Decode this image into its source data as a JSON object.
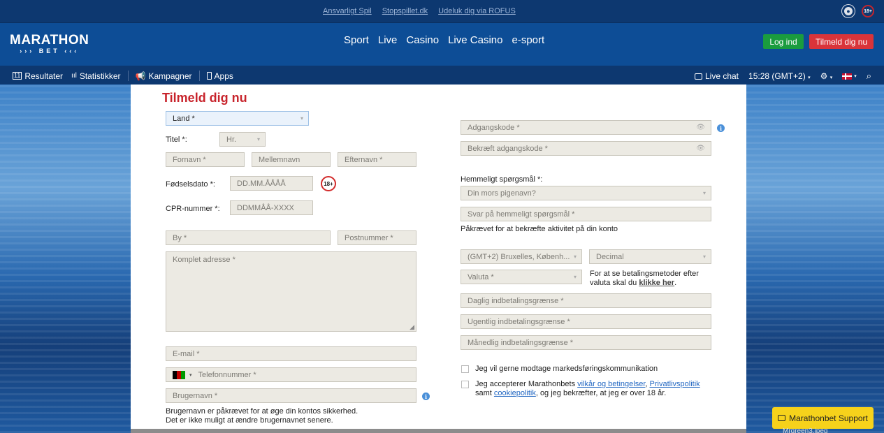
{
  "topbar": {
    "links": [
      "Ansvarligt Spil",
      "Stopspillet.dk",
      "Udeluk dig via ROFUS"
    ],
    "age_badge": "18+"
  },
  "header": {
    "logo_main": "MARATHON",
    "logo_sub": "BET",
    "nav": [
      "Sport",
      "Live",
      "Casino",
      "Live Casino",
      "e-sport"
    ],
    "login_label": "Log ind",
    "signup_label": "Tilmeld dig nu"
  },
  "subnav": {
    "results": "Resultater",
    "stats": "Statistikker",
    "promos": "Kampagner",
    "apps": "Apps",
    "live_chat": "Live chat",
    "time": "15:28 (GMT+2)"
  },
  "form": {
    "title": "Tilmeld dig nu",
    "country": "Land *",
    "title_label": "Titel *:",
    "title_value": "Hr.",
    "first_name": "Fornavn *",
    "middle_name": "Mellemnavn",
    "last_name": "Efternavn *",
    "dob_label": "Fødselsdato *:",
    "dob_placeholder": "DD.MM.ÅÅÅÅ",
    "age_badge": "18+",
    "cpr_label": "CPR-nummer *:",
    "cpr_placeholder": "DDMMÅÅ-XXXX",
    "city": "By *",
    "postal": "Postnummer *",
    "address": "Komplet adresse *",
    "email": "E-mail *",
    "phone": "Telefonnummer *",
    "username": "Brugernavn *",
    "username_note_1": "Brugernavn er påkrævet for at øge din kontos sikkerhed.",
    "username_note_2": "Det er ikke muligt at ændre brugernavnet senere.",
    "password": "Adgangskode *",
    "password_confirm": "Bekræft adgangskode *",
    "secret_q_label": "Hemmeligt spørgsmål *:",
    "secret_q_value": "Din mors pigenavn?",
    "secret_answer": "Svar på hemmeligt spørgsmål *",
    "secret_note": "Påkrævet for at bekræfte aktivitet på din konto",
    "timezone": "(GMT+2) Bruxelles, Københ...",
    "odds_format": "Decimal",
    "currency": "Valuta *",
    "currency_note_1": "For at se betalingsmetoder efter",
    "currency_note_2": "valuta skal du",
    "currency_link": "klikke her",
    "daily_limit": "Daglig indbetalingsgrænse *",
    "weekly_limit": "Ugentlig indbetalingsgrænse *",
    "monthly_limit": "Månedlig indbetalingsgrænse *",
    "marketing": "Jeg vil gerne modtage markedsføringskommunikation",
    "terms_1": "Jeg accepterer Marathonbets",
    "terms_link_1": "vilkår og betingelser",
    "terms_link_2": "Privatlivspolitik",
    "terms_2": "samt",
    "terms_link_3": "cookiepolitik",
    "terms_3": ", og jeg bekræfter, at jeg er over 18 år."
  },
  "support": {
    "label": "Marathonbet Support",
    "bg_file": "Mrgreen3.jpeg"
  },
  "colors": {
    "brand_blue": "#0d4d96",
    "dark_blue": "#0d3870",
    "accent_red": "#c8242c",
    "login_green": "#1a9c3e",
    "support_yellow": "#f6d21b"
  }
}
